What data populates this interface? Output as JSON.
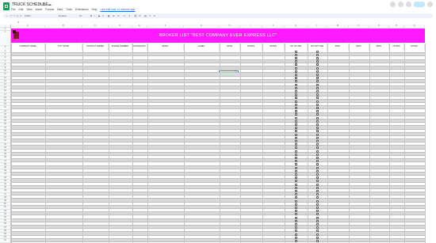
{
  "app": {
    "title": "TRUCK SCHEDULE",
    "last_edit": "Last edit was 14 minutes ago",
    "menu": [
      "File",
      "Edit",
      "View",
      "Insert",
      "Format",
      "Data",
      "Tools",
      "Extensions",
      "Help"
    ],
    "toolbar": {
      "zoom": "100%",
      "font": "Default",
      "font_size": "10"
    }
  },
  "sheet": {
    "columns": [
      "A",
      "B",
      "C",
      "D",
      "E",
      "F",
      "G",
      "H",
      "I",
      "J",
      "K",
      "L",
      "M",
      "N",
      "O",
      "P",
      "Q"
    ],
    "banner_title": "BROKER LIST  \"BEST COMPANY EVER EXPRESS LLC\"",
    "headers": [
      "COMPANY NAME",
      "CITY STATE",
      "CONTACT NAMES",
      "PHONE NUMBER",
      "EXTENSION",
      "EMAIL",
      "LANES",
      "RATE",
      "NOTES",
      "NOTES",
      "OK TO USE",
      "DO NOT USE",
      "MISC",
      "MISC",
      "MISC",
      "NOTES",
      "NOTES"
    ],
    "row_count": 58,
    "checkbox_columns": [
      "OK TO USE",
      "DO NOT USE"
    ],
    "colors": {
      "banner": "#ff1aff",
      "band": "#d9d9d9",
      "selection": "#1a73e8"
    }
  }
}
